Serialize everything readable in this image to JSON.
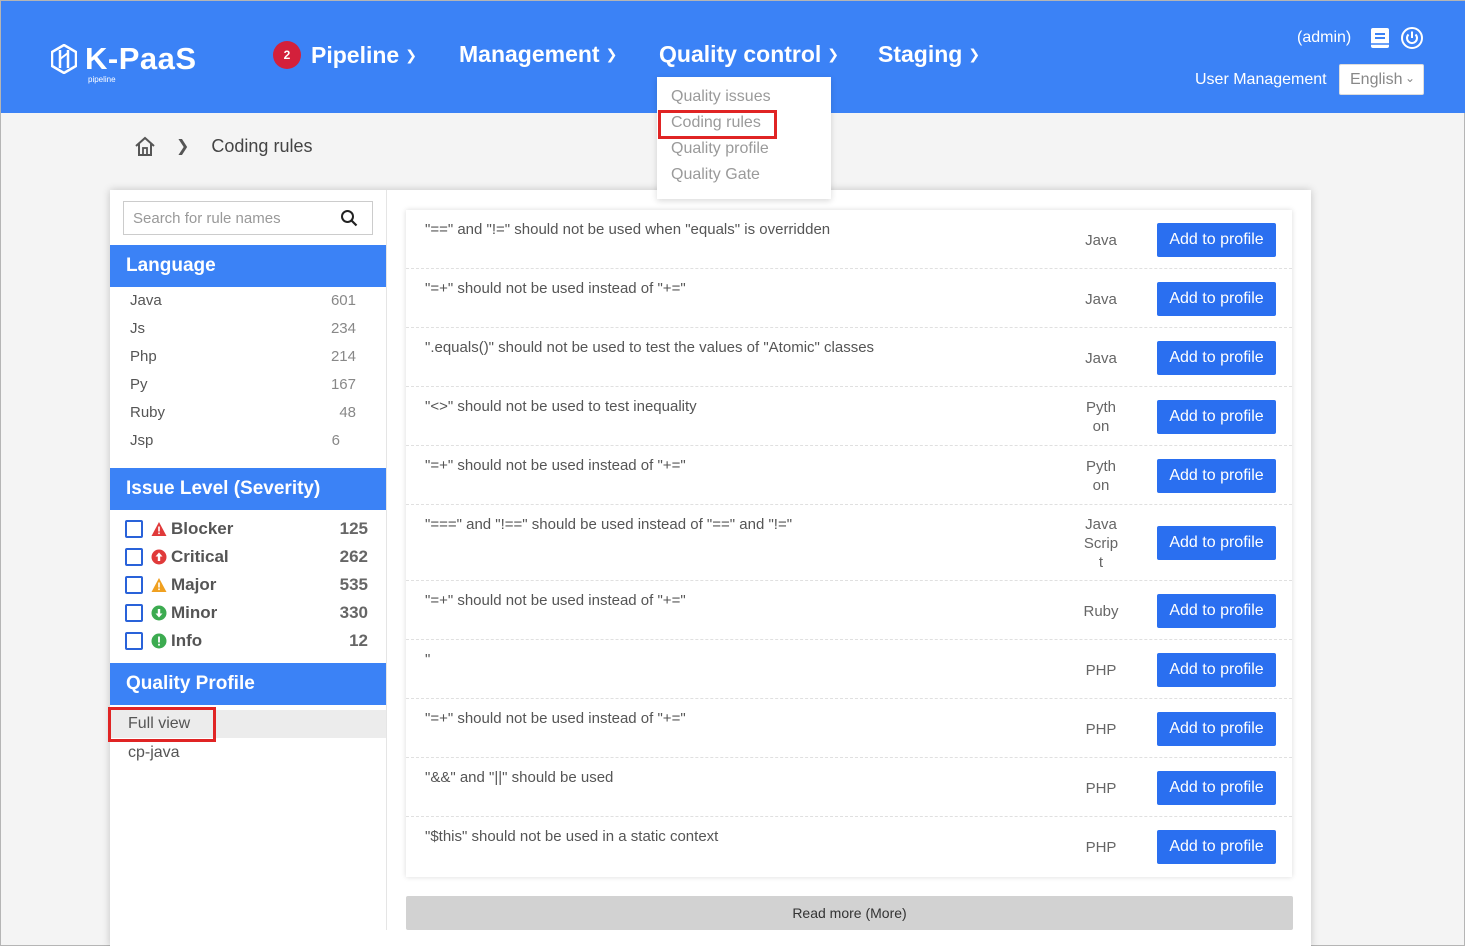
{
  "header": {
    "logo_text": "K-PaaS",
    "logo_sub": "pipeline",
    "nav": [
      {
        "label": "Pipeline",
        "badge": "2"
      },
      {
        "label": "Management"
      },
      {
        "label": "Quality control"
      },
      {
        "label": "Staging"
      }
    ],
    "admin": "(admin)",
    "user_management": "User Management",
    "language": "English"
  },
  "dropdown": [
    "Quality issues",
    "Coding rules",
    "Quality profile",
    "Quality Gate"
  ],
  "breadcrumb": {
    "current": "Coding rules"
  },
  "sidebar": {
    "search_placeholder": "Search for rule names",
    "language_title": "Language",
    "languages": [
      {
        "name": "Java",
        "count": "601"
      },
      {
        "name": "Js",
        "count": "234"
      },
      {
        "name": "Php",
        "count": "214"
      },
      {
        "name": "Py",
        "count": "167"
      },
      {
        "name": "Ruby",
        "count": "48"
      },
      {
        "name": "Jsp",
        "count": "6"
      }
    ],
    "severity_title": "Issue Level (Severity)",
    "severities": [
      {
        "name": "Blocker",
        "count": "125",
        "color": "#e03a3a"
      },
      {
        "name": "Critical",
        "count": "262",
        "color": "#e03a3a"
      },
      {
        "name": "Major",
        "count": "535",
        "color": "#f0a020"
      },
      {
        "name": "Minor",
        "count": "330",
        "color": "#3cab50"
      },
      {
        "name": "Info",
        "count": "12",
        "color": "#3cab50"
      }
    ],
    "profile_title": "Quality Profile",
    "profiles": [
      "Full view",
      "cp-java"
    ]
  },
  "rules": [
    {
      "name": "\"==\" and \"!=\" should not be used when \"equals\" is overridden",
      "lang": "Java"
    },
    {
      "name": "\"=+\" should not be used instead of \"+=\"",
      "lang": "Java"
    },
    {
      "name": "\".equals()\" should not be used to test the values of \"Atomic\" classes",
      "lang": "Java"
    },
    {
      "name": "\"<>\" should not be used to test inequality",
      "lang": "Pyth on"
    },
    {
      "name": "\"=+\" should not be used instead of \"+=\"",
      "lang": "Pyth on"
    },
    {
      "name": "\"===\" and \"!==\" should be used instead of \"==\" and \"!=\"",
      "lang": "Java Scrip t"
    },
    {
      "name": "\"=+\" should not be used instead of \"+=\"",
      "lang": "Ruby"
    },
    {
      "name": "\"",
      "lang": "PHP"
    },
    {
      "name": "\"=+\" should not be used instead of \"+=\"",
      "lang": "PHP"
    },
    {
      "name": "\"&&\" and \"||\" should be used",
      "lang": "PHP"
    },
    {
      "name": "\"$this\" should not be used in a static context",
      "lang": "PHP"
    }
  ],
  "add_button_label": "Add to profile",
  "read_more": "Read more (More)"
}
